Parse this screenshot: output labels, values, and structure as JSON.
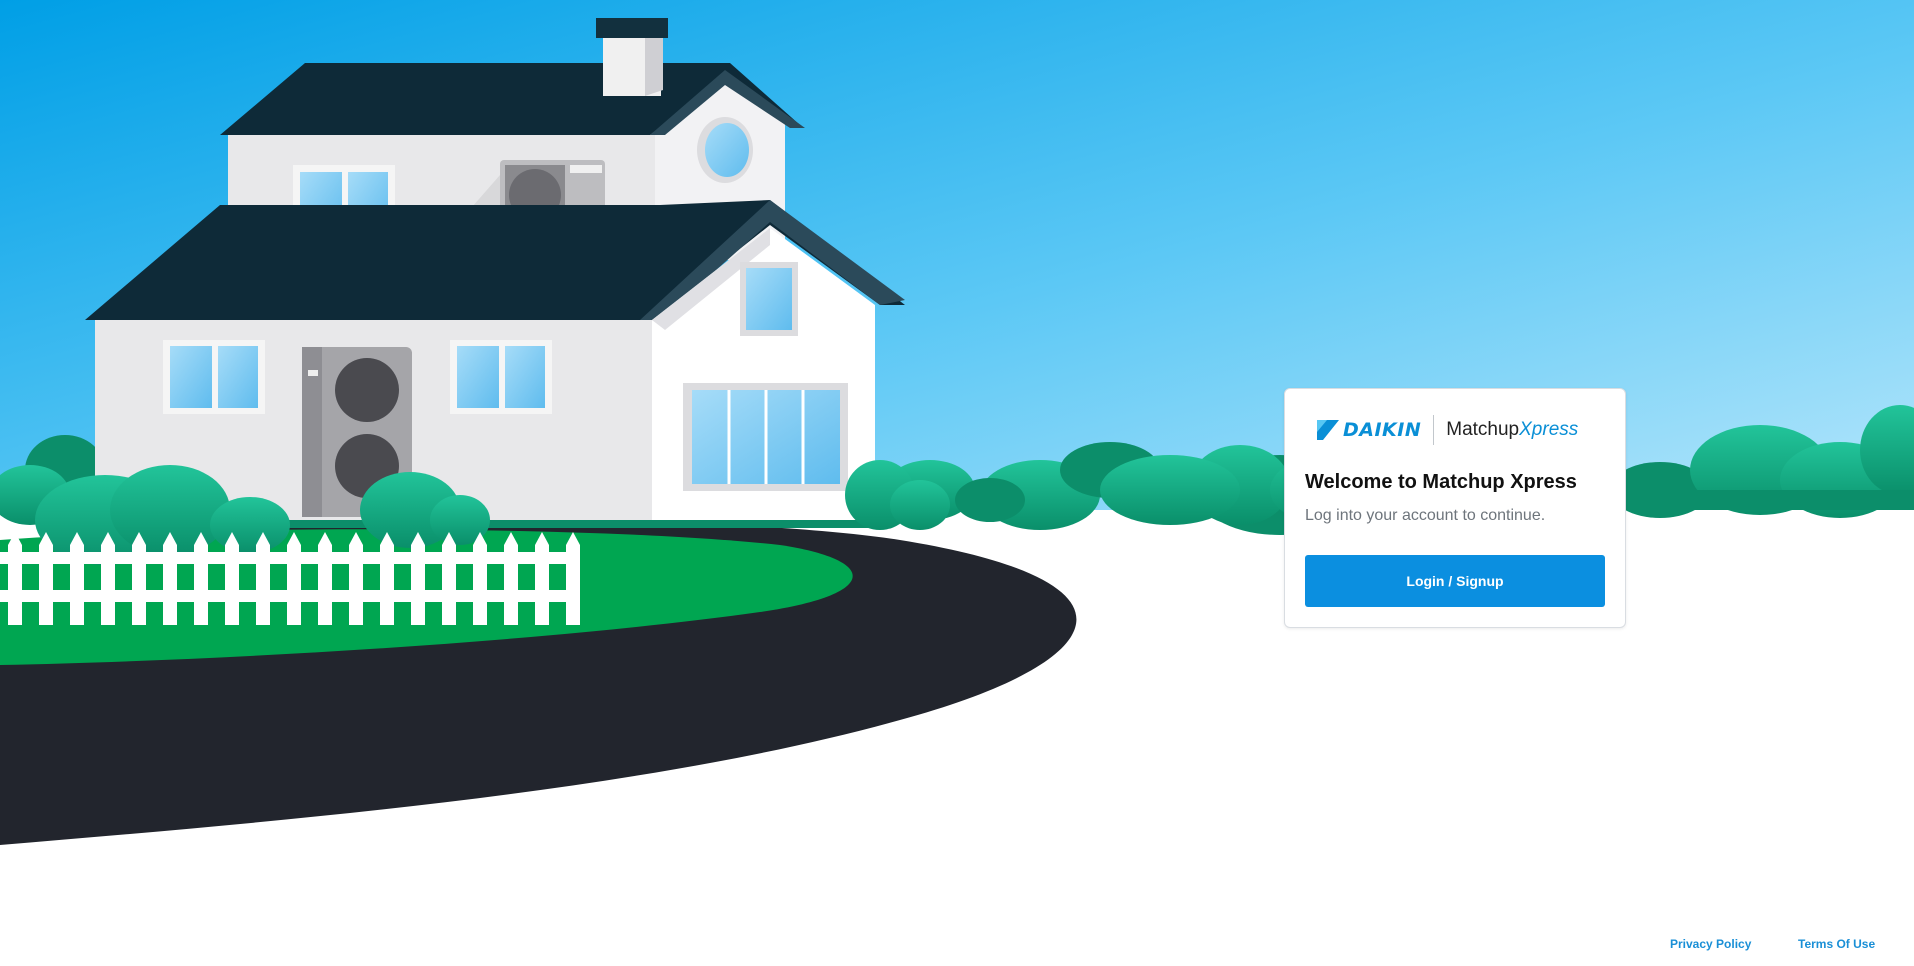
{
  "card": {
    "brand": "DAIKIN",
    "product_first": "Matchup",
    "product_second": "Xpress",
    "welcome_title": "Welcome to Matchup Xpress",
    "subtitle": "Log into your account to continue.",
    "login_button": "Login / Signup"
  },
  "footer": {
    "privacy": "Privacy Policy",
    "terms": "Terms Of Use"
  },
  "colors": {
    "brand_blue": "#0a8fd6",
    "button_blue": "#0b8fe0",
    "sky_top": "#00a5e8",
    "roof": "#0e2a38",
    "lawn": "#00a651",
    "road": "#22252d"
  }
}
